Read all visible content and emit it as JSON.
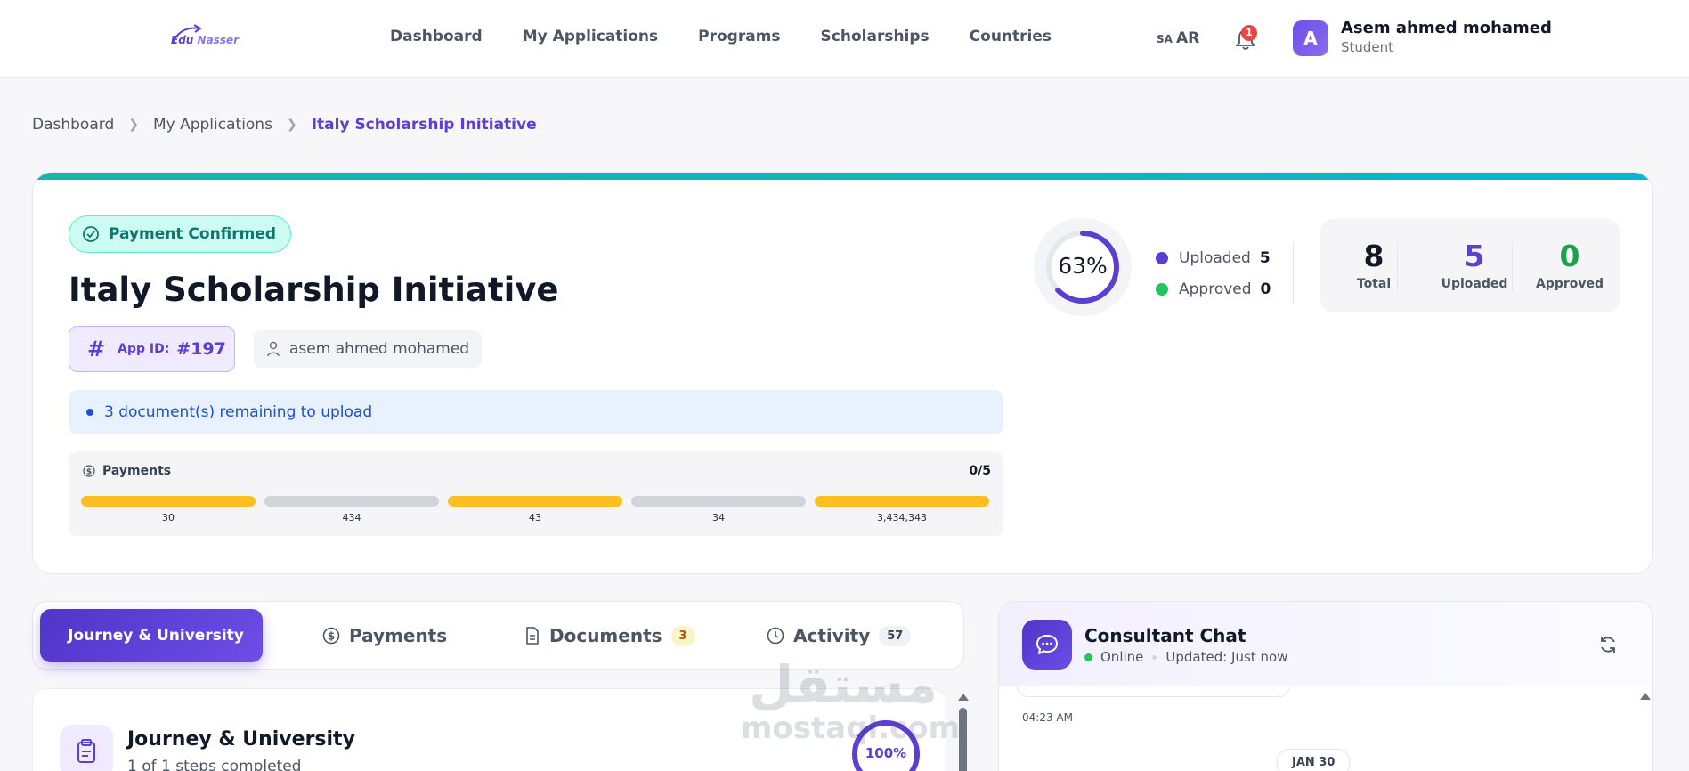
{
  "brand": {
    "logo_line1": "Edu",
    "logo_line2": "Nasser"
  },
  "nav": {
    "links": [
      "Dashboard",
      "My Applications",
      "Programs",
      "Scholarships",
      "Countries"
    ],
    "lang_flag": "SA",
    "lang_label": "AR",
    "notif_count": "1",
    "user": {
      "initial": "A",
      "name": "Asem ahmed mohamed",
      "role": "Student"
    }
  },
  "breadcrumb": [
    "Dashboard",
    "My Applications",
    "Italy Scholarship Initiative"
  ],
  "application": {
    "payment_status": "Payment Confirmed",
    "title": "Italy Scholarship Initiative",
    "app_id_label": "App ID:",
    "app_id": "#197",
    "owner": "asem ahmed mohamed",
    "remaining_notice": "3 document(s) remaining to upload",
    "payments": {
      "label": "Payments",
      "count": "0/5",
      "segments": [
        {
          "amount": "30",
          "color": "#fbbf24"
        },
        {
          "amount": "434",
          "color": "#d1d5db"
        },
        {
          "amount": "43",
          "color": "#fbbf24"
        },
        {
          "amount": "34",
          "color": "#d1d5db"
        },
        {
          "amount": "3,434,343",
          "color": "#fbbf24"
        }
      ]
    },
    "progress_percent": 63,
    "progress_label": "63%",
    "legend": [
      {
        "label": "Uploaded",
        "value": "5",
        "color": "#5b3fd0"
      },
      {
        "label": "Approved",
        "value": "0",
        "color": "#22c55e"
      }
    ],
    "stats": [
      {
        "value": "8",
        "caption": "Total",
        "color": "#111827"
      },
      {
        "value": "5",
        "caption": "Uploaded",
        "color": "#5b3fd0"
      },
      {
        "value": "0",
        "caption": "Approved",
        "color": "#16a34a"
      }
    ]
  },
  "tabs": [
    {
      "label": "Journey & University",
      "active": true,
      "count": ""
    },
    {
      "label": "Payments",
      "active": false,
      "count": ""
    },
    {
      "label": "Documents",
      "active": false,
      "count": "3"
    },
    {
      "label": "Activity",
      "active": false,
      "count": "57"
    }
  ],
  "journey": {
    "title": "Journey & University",
    "subtitle": "1 of 1 steps completed",
    "percent_label": "100%"
  },
  "chat": {
    "title": "Consultant Chat",
    "status": "Online",
    "updated": "Updated: Just now",
    "message_time": "04:23 AM",
    "date_separator": "JAN 30"
  },
  "watermark": {
    "arabic": "مستقل",
    "latin": "mostaql.com"
  },
  "colors": {
    "accent": "#5b3fd0",
    "teal": "#14b8a6",
    "success": "#22c55e",
    "warning": "#fbbf24",
    "danger": "#ef4444"
  }
}
